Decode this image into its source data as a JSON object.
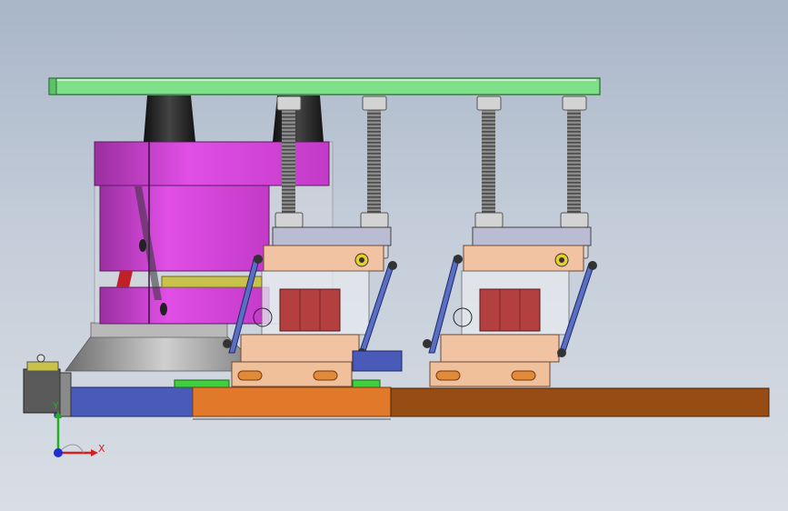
{
  "viewport": {
    "background_top": "#a9b6c8",
    "background_bottom": "#d9dee5"
  },
  "model": {
    "top_plate_color": "#7fe08a",
    "body_color": "#d43bd4",
    "base_plate_color": "#e07a2a",
    "rail_color": "#964c12",
    "slider_color": "#f0c09a",
    "rod_color": "#6f6f6f",
    "nut_color": "#cfcfcf",
    "bracket_color": "#5a6fc2",
    "pad_color": "#b8403c"
  },
  "triad": {
    "x_label": "X",
    "y_label": "Y",
    "x_color": "#d42020",
    "y_color": "#20b020",
    "z_color": "#2030d0"
  }
}
